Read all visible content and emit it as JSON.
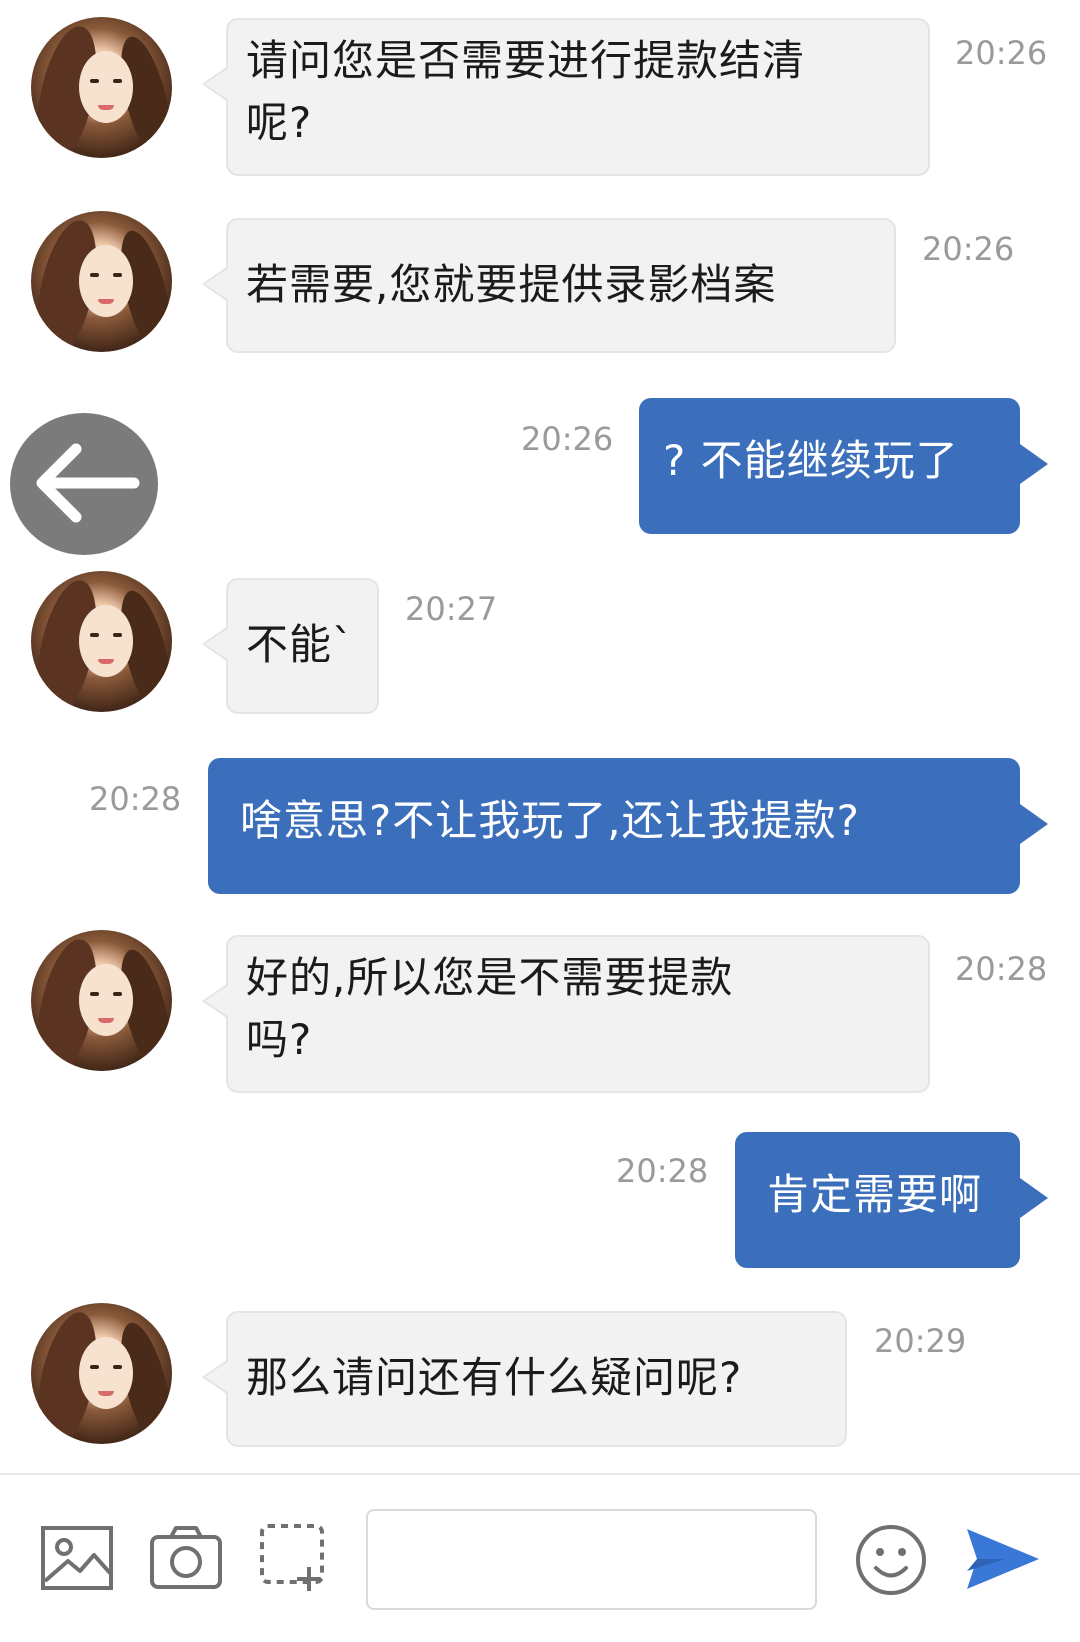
{
  "messages": [
    {
      "side": "in",
      "lines": [
        "请问您是否需要进行提款结清",
        "呢?"
      ],
      "time": "20:26"
    },
    {
      "side": "in",
      "lines": [
        "若需要,您就要提供录影档案"
      ],
      "time": "20:26"
    },
    {
      "side": "out",
      "lines": [
        "? 不能继续玩了"
      ],
      "time": "20:26"
    },
    {
      "side": "in",
      "lines": [
        "不能`"
      ],
      "time": "20:27"
    },
    {
      "side": "out",
      "lines": [
        "啥意思?不让我玩了,还让我提款?"
      ],
      "time": "20:28"
    },
    {
      "side": "in",
      "lines": [
        "好的,所以您是不需要提款",
        "吗?"
      ],
      "time": "20:28"
    },
    {
      "side": "out",
      "lines": [
        "肯定需要啊"
      ],
      "time": "20:28"
    },
    {
      "side": "in",
      "lines": [
        "那么请问还有什么疑问呢?"
      ],
      "time": "20:29"
    }
  ],
  "composer": {
    "message_value": "",
    "icons": [
      "image-icon",
      "camera-icon",
      "screenshot-icon",
      "emoji-icon",
      "send-icon",
      "back-arrow-icon"
    ]
  },
  "colors": {
    "outgoing_bubble": "#3b6fbb",
    "incoming_bubble": "#f2f2f2",
    "timestamp": "#9a9a9a",
    "back_button": "#7b7b7b",
    "send_icon": "#3a78d8"
  }
}
